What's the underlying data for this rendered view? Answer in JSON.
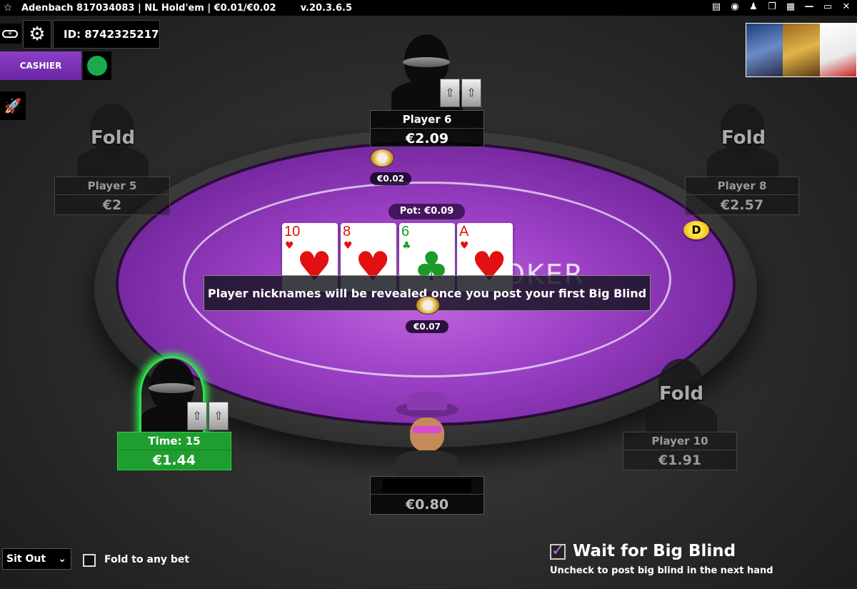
{
  "titlebar": {
    "star_icon": "star-icon",
    "title": "Adenbach 817034083 | NL Hold'em | €0.01/€0.02",
    "version": "v.20.3.6.5"
  },
  "top_left": {
    "id_label": "ID: 8742325217",
    "cashier_label": "CASHIER"
  },
  "table": {
    "pot_label": "Pot: €0.09",
    "logo_text_right": "OKER",
    "message": "Player nicknames will be revealed once you post your first Big Blind",
    "dealer_label": "D"
  },
  "board": [
    {
      "rank": "10",
      "suit": "♥",
      "color": "red"
    },
    {
      "rank": "8",
      "suit": "♥",
      "color": "red"
    },
    {
      "rank": "6",
      "suit": "♣",
      "color": "green"
    },
    {
      "rank": "A",
      "suit": "♥",
      "color": "red"
    }
  ],
  "bets": {
    "player6": "€0.02",
    "center": "€0.07"
  },
  "seats": {
    "player5": {
      "name": "Player 5",
      "stack": "€2",
      "status": "Fold"
    },
    "player6": {
      "name": "Player 6",
      "stack": "€2.09"
    },
    "player8": {
      "name": "Player 8",
      "stack": "€2.57",
      "status": "Fold"
    },
    "player10": {
      "name": "Player 10",
      "stack": "€1.91",
      "status": "Fold"
    },
    "hero": {
      "stack": "€0.80"
    },
    "active": {
      "timer": "Time: 15",
      "stack": "€1.44"
    }
  },
  "controls": {
    "sit_out_value": "Sit Out",
    "fold_any_label": "Fold to any bet",
    "wait_bb_label": "Wait for Big Blind",
    "wait_bb_sub": "Uncheck to post big blind in the next hand",
    "wait_bb_checked": true
  },
  "colors": {
    "felt": "#9a3fc4",
    "active_seat": "#1e9e2e",
    "cashier": "#7a30b4"
  }
}
